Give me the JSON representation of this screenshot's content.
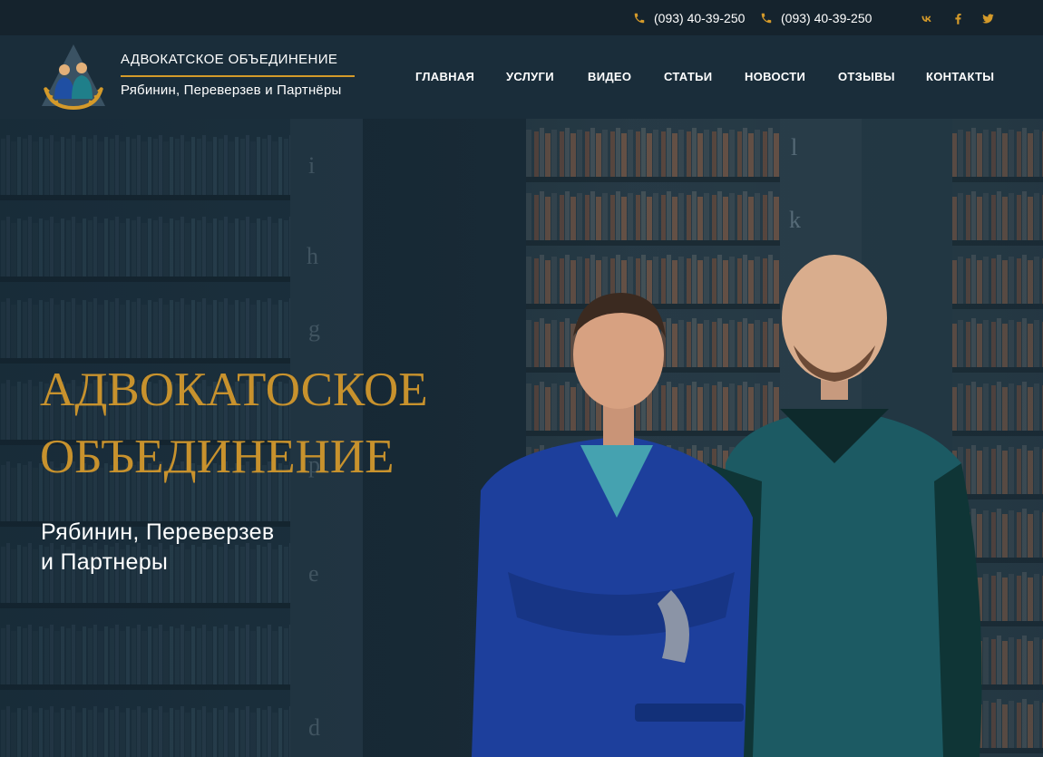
{
  "topbar": {
    "phones": [
      "(093) 40-39-250",
      "(093) 40-39-250"
    ],
    "social": [
      "vk-icon",
      "facebook-icon",
      "twitter-icon"
    ]
  },
  "header": {
    "logo_title": "АДВОКАТСКОЕ ОБЪЕДИНЕНИЕ",
    "logo_subtitle": "Рябинин, Переверзев и Партнёры",
    "nav": [
      "ГЛАВНАЯ",
      "УСЛУГИ",
      "ВИДЕО",
      "СТАТЬИ",
      "НОВОСТИ",
      "ОТЗЫВЫ",
      "КОНТАКТЫ"
    ]
  },
  "hero": {
    "title_line1": "АДВОКАТОСКОЕ",
    "title_line2": "ОБЪЕДИНЕНИЕ",
    "subtitle_line1": "Рябинин, Переверзев",
    "subtitle_line2": "и Партнеры"
  },
  "colors": {
    "accent": "#d49a2a",
    "hero_title": "#c8922d",
    "header_bg": "#1a2d3a",
    "topbar_bg": "#15232d"
  }
}
